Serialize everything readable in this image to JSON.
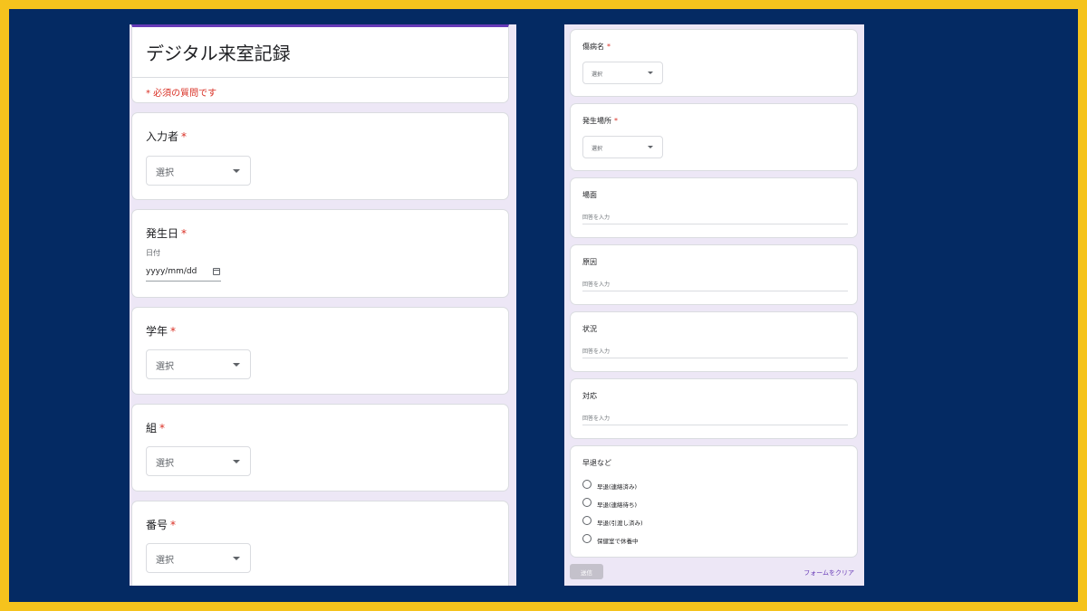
{
  "form": {
    "title": "デジタル来室記録",
    "required_note": "* 必須の質問です",
    "asterisk": "*",
    "entered_by": {
      "label": "入力者",
      "select_value": "選択"
    },
    "date": {
      "label": "発生日",
      "sub_label": "日付",
      "value": "yyyy/mm/dd"
    },
    "grade": {
      "label": "学年",
      "select_value": "選択"
    },
    "class": {
      "label": "組",
      "select_value": "選択"
    },
    "number": {
      "label": "番号",
      "select_value": "選択"
    },
    "illness": {
      "label": "傷病名",
      "select_value": "選択"
    },
    "location": {
      "label": "発生場所",
      "select_value": "選択"
    },
    "scene": {
      "label": "場面",
      "placeholder": "回答を入力"
    },
    "cause": {
      "label": "原因",
      "placeholder": "回答を入力"
    },
    "situation": {
      "label": "状況",
      "placeholder": "回答を入力"
    },
    "response": {
      "label": "対応",
      "placeholder": "回答を入力"
    },
    "early_leave": {
      "label": "早退など",
      "options": [
        "早退(連絡済み)",
        "早退(連絡待ち)",
        "早退(引渡し済み)",
        "保健室で休養中"
      ]
    },
    "submit_label": "送信",
    "clear_label": "フォームをクリア"
  },
  "colors": {
    "frame": "#f5c31d",
    "background": "#042a63",
    "accent": "#673ab7",
    "required": "#d93025",
    "form_bg": "#ede7f6"
  }
}
